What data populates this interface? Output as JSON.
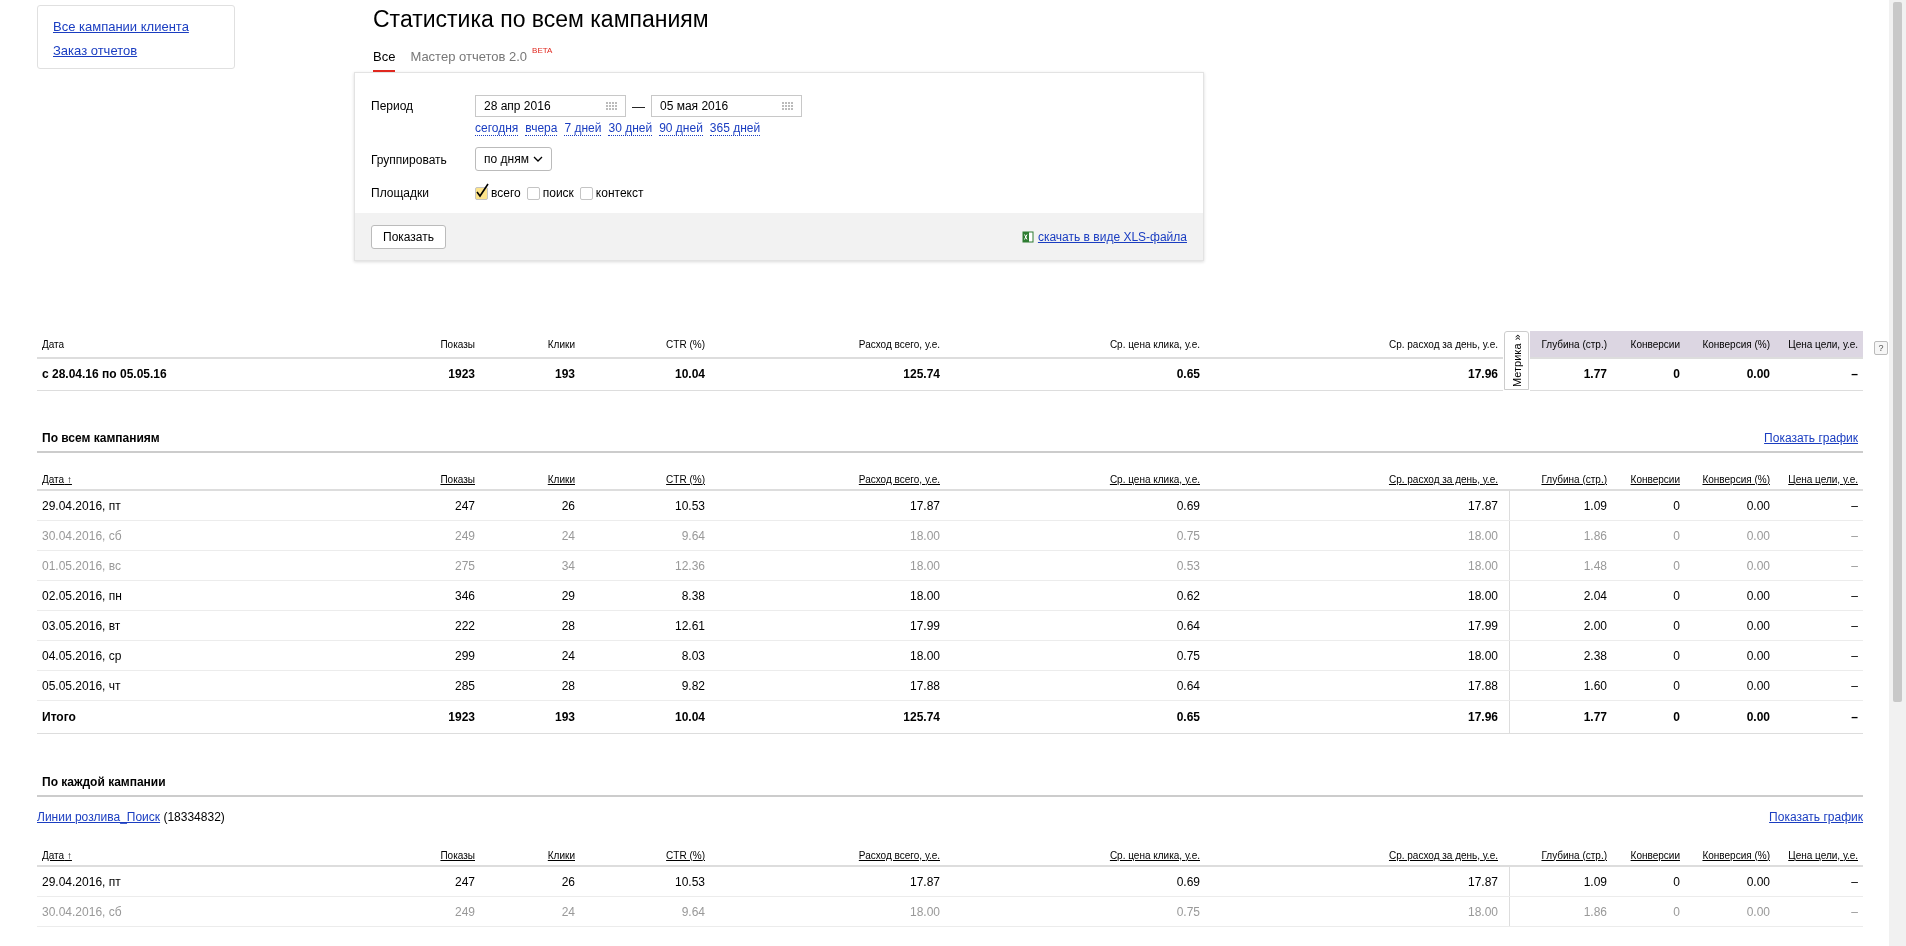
{
  "sidebar": {
    "links": [
      "Все кампании клиента",
      "Заказ отчетов"
    ]
  },
  "title": "Статистика по всем кампаниям",
  "tabs": [
    {
      "label": "Все",
      "selected": true
    },
    {
      "label": "Мастер отчетов 2.0",
      "badge": "BETA",
      "selected": false
    }
  ],
  "filters": {
    "period_label": "Период",
    "date_from": "28 апр 2016",
    "separator": "—",
    "date_to": "05 мая 2016",
    "presets": [
      "сегодня",
      "вчера",
      "7 дней",
      "30 дней",
      "90 дней",
      "365 дней"
    ],
    "group_label": "Группировать",
    "group_value": "по дням",
    "sites_label": "Площадки",
    "sites": [
      {
        "label": "всего",
        "checked": true
      },
      {
        "label": "поиск",
        "checked": false
      },
      {
        "label": "контекст",
        "checked": false
      }
    ],
    "show_button": "Показать",
    "download_link": "скачать в виде XLS-файла"
  },
  "summary": {
    "columns": [
      "Дата",
      "Показы",
      "Клики",
      "CTR (%)",
      "Расход всего, у.е.",
      "Ср. цена клика, у.е.",
      "Ср. расход за день, у.е.",
      "Глубина (стр.)",
      "Конверсии",
      "Конверсия (%)",
      "Цена цели, у.е."
    ],
    "metrika_tab": "Метрика »",
    "help": "?",
    "row": [
      "с 28.04.16 по 05.05.16",
      "1923",
      "193",
      "10.04",
      "125.74",
      "0.65",
      "17.96",
      "1.77",
      "0",
      "0.00",
      "–"
    ]
  },
  "sections": [
    {
      "heading": "По всем кампаниям",
      "chart_link": "Показать график",
      "sort_arrow": "↑",
      "columns": [
        "Дата",
        "Показы",
        "Клики",
        "CTR (%)",
        "Расход всего, у.е.",
        "Ср. цена клика, у.е.",
        "Ср. расход за день, у.е.",
        "Глубина (стр.)",
        "Конверсии",
        "Конверсия (%)",
        "Цена цели, у.е."
      ],
      "rows": [
        {
          "dimmed": false,
          "cells": [
            "29.04.2016, пт",
            "247",
            "26",
            "10.53",
            "17.87",
            "0.69",
            "17.87",
            "1.09",
            "0",
            "0.00",
            "–"
          ]
        },
        {
          "dimmed": true,
          "cells": [
            "30.04.2016, сб",
            "249",
            "24",
            "9.64",
            "18.00",
            "0.75",
            "18.00",
            "1.86",
            "0",
            "0.00",
            "–"
          ]
        },
        {
          "dimmed": true,
          "cells": [
            "01.05.2016, вс",
            "275",
            "34",
            "12.36",
            "18.00",
            "0.53",
            "18.00",
            "1.48",
            "0",
            "0.00",
            "–"
          ]
        },
        {
          "dimmed": false,
          "cells": [
            "02.05.2016, пн",
            "346",
            "29",
            "8.38",
            "18.00",
            "0.62",
            "18.00",
            "2.04",
            "0",
            "0.00",
            "–"
          ]
        },
        {
          "dimmed": false,
          "cells": [
            "03.05.2016, вт",
            "222",
            "28",
            "12.61",
            "17.99",
            "0.64",
            "17.99",
            "2.00",
            "0",
            "0.00",
            "–"
          ]
        },
        {
          "dimmed": false,
          "cells": [
            "04.05.2016, ср",
            "299",
            "24",
            "8.03",
            "18.00",
            "0.75",
            "18.00",
            "2.38",
            "0",
            "0.00",
            "–"
          ]
        },
        {
          "dimmed": false,
          "cells": [
            "05.05.2016, чт",
            "285",
            "28",
            "9.82",
            "17.88",
            "0.64",
            "17.88",
            "1.60",
            "0",
            "0.00",
            "–"
          ]
        }
      ],
      "total": [
        "Итого",
        "1923",
        "193",
        "10.04",
        "125.74",
        "0.65",
        "17.96",
        "1.77",
        "0",
        "0.00",
        "–"
      ]
    },
    {
      "heading": "По каждой кампании",
      "campaign": {
        "link": "Линии розлива_Поиск",
        "id": "(18334832)"
      },
      "chart_link": "Показать график",
      "sort_arrow": "↑",
      "columns": [
        "Дата",
        "Показы",
        "Клики",
        "CTR (%)",
        "Расход всего, у.е.",
        "Ср. цена клика, у.е.",
        "Ср. расход за день, у.е.",
        "Глубина (стр.)",
        "Конверсии",
        "Конверсия (%)",
        "Цена цели, у.е."
      ],
      "rows": [
        {
          "dimmed": false,
          "cells": [
            "29.04.2016, пт",
            "247",
            "26",
            "10.53",
            "17.87",
            "0.69",
            "17.87",
            "1.09",
            "0",
            "0.00",
            "–"
          ]
        },
        {
          "dimmed": true,
          "cells": [
            "30.04.2016, сб",
            "249",
            "24",
            "9.64",
            "18.00",
            "0.75",
            "18.00",
            "1.86",
            "0",
            "0.00",
            "–"
          ]
        }
      ]
    }
  ]
}
